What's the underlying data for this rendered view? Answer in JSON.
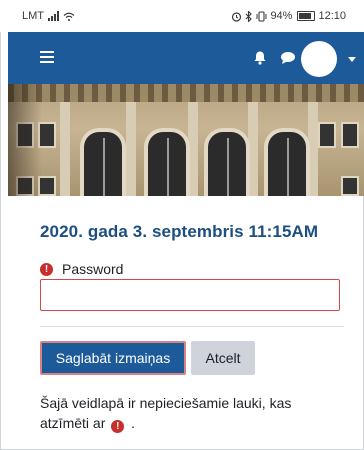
{
  "status_bar": {
    "carrier": "LMT",
    "right_text": "94%",
    "time": "12:10",
    "icons": [
      "signal-icon",
      "wifi-icon",
      "alarm-icon",
      "bluetooth-icon",
      "vibrate-icon",
      "battery-icon"
    ]
  },
  "navbar": {
    "color": "#1d5a99",
    "icons": [
      "menu-icon",
      "bell-icon",
      "chat-icon",
      "avatar",
      "caret-down-icon"
    ]
  },
  "page": {
    "heading": "2020. gada 3. septembris 11:15AM",
    "password_label": "Password",
    "password_value": "",
    "save_label": "Saglabāt izmaiņas",
    "cancel_label": "Atcelt",
    "required_note": "Šajā veidlapā ir nepieciešamie lauki, kas atzīmēti ar",
    "required_note_tail": ".",
    "error_color": "#c72e2e"
  }
}
